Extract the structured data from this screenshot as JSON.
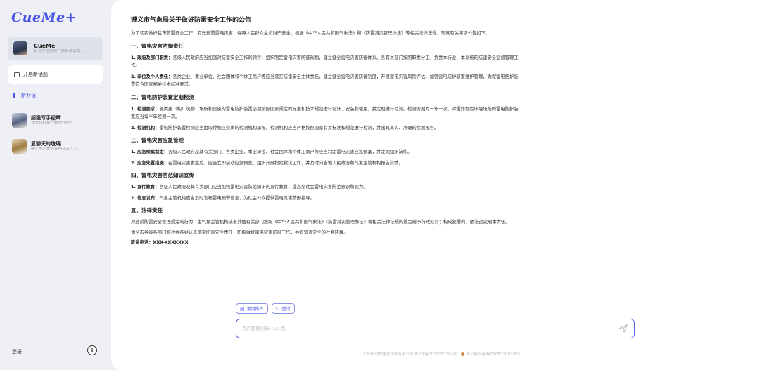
{
  "app": {
    "logo": "CueMe+"
  },
  "sidebar": {
    "agent": {
      "name": "CueMe",
      "desc": "有写作任务吗？快来试试我..."
    },
    "new_chat_label": "开启新话题",
    "section_label": "新对话",
    "history": [
      {
        "title": "超强写手程章",
        "desc": "快来找程章一起创作吧~"
      },
      {
        "title": "爱聊天的琉璃",
        "desc": "嘿？刚才是你在叫我么~（..."
      }
    ],
    "login_label": "登录",
    "info_glyph": "i"
  },
  "document": {
    "title": "遵义市气象局关于做好防雷安全工作的公告",
    "intro": "为了切实做好我市防雷安全工作，有效预防雷电灾害，保障人民群众生命财产安全，根据《中华人民共和国气象法》和《防雷减灾管理办法》等相关法律法规，现就有关事项公告如下：",
    "sections": [
      {
        "heading": "一、雷电灾害防御责任",
        "items": [
          {
            "label": "1. 政府及部门职责：",
            "text": "各级人民政府应当加强对防雷安全工作的领导，组织制定雷电灾害防御规划，建立健全雷电灾害防御体系。各有关部门按照职责分工，负责本行业、本系统的防雷安全监督管理工作。"
          },
          {
            "label": "2. 单位及个人责任：",
            "text": "各类企业、事业单位、社会团体和个体工商户等应当落实防雷安全主体责任，建立健全雷电灾害防御制度，开展雷电灾害风险评估，加强雷电防护装置维护管理，确保雷电防护装置符合国家相关技术标准要求。"
          }
        ]
      },
      {
        "heading": "二、雷电防护装置定期检测",
        "items": [
          {
            "label": "1. 检测要求：",
            "text": "各类建（构）筑物、场所和设施的雷电防护装置必须按照国家规定的标准和技术规范进行设计、安装和使用，并定期进行检测。检测周期为一年一次，对爆炸危险环境场所的雷电防护装置应当每半年检测一次。"
          },
          {
            "label": "2. 检测机构：",
            "text": "雷电防护装置检测应当由取得相应资质的检测机构承担。检测机构应当严格按照国家有关标准和规范进行检测，并出具真实、准确的检测报告。"
          }
        ]
      },
      {
        "heading": "三、雷电灾害应急管理",
        "items": [
          {
            "label": "1. 应急预案制定：",
            "text": "各级人民政府及其有关部门、各类企业、事业单位、社会团体和个体工商户等应当制定雷电灾害应急预案，并定期组织演练。"
          },
          {
            "label": "2. 应急处置措施：",
            "text": "在雷电灾害发生后，应当立即启动应急预案，组织开展抢险救灾工作，并及时向当地人民政府和气象主管机构报告灾情。"
          }
        ]
      },
      {
        "heading": "四、雷电灾害防范知识宣传",
        "items": [
          {
            "label": "1. 宣传教育：",
            "text": "各级人民政府及其有关部门应当加强雷电灾害防范知识的宣传教育，提高全社会雷电灾害防范意识和能力。"
          },
          {
            "label": "2. 信息发布：",
            "text": "气象主管机构应当及时发布雷电预警信息，为社会公众提供雷电灾害防御指导。"
          }
        ]
      },
      {
        "heading": "五、法律责任",
        "items": []
      }
    ],
    "law_para": "对违反防雷安全管理规定的行为，由气象主管机构或者其他有关部门按照《中华人民共和国气象法》《防雷减灾管理办法》等相关法律法规的规定给予行政处罚；构成犯罪的，依法追究刑事责任。",
    "closing": "请全市各级各部门和社会各界认真落实防雷安全责任，积极做好雷电灾害防御工作，共同营造安全的社会环境。",
    "contact": "联系电话：XXX-XXXXXXX"
  },
  "actions": {
    "common_cmd": "常用指令",
    "retry": "重试"
  },
  "input": {
    "placeholder": "有问题随时来 cue 我"
  },
  "footer": {
    "icp": "广州市动悦信息技术有限公司 粤ICP备2022013384号",
    "police": "粤公网安备44010502003055"
  }
}
